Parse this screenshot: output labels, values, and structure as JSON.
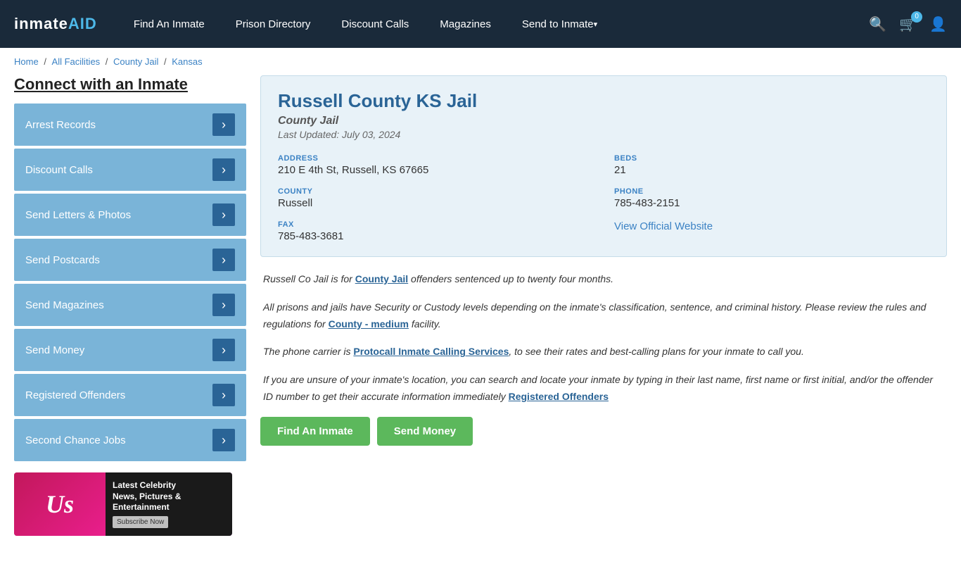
{
  "header": {
    "logo": "inmateAID",
    "nav": [
      {
        "label": "Find An Inmate",
        "dropdown": false
      },
      {
        "label": "Prison Directory",
        "dropdown": false
      },
      {
        "label": "Discount Calls",
        "dropdown": false
      },
      {
        "label": "Magazines",
        "dropdown": false
      },
      {
        "label": "Send to Inmate",
        "dropdown": true
      }
    ],
    "cart_count": "0"
  },
  "breadcrumb": {
    "items": [
      "Home",
      "All Facilities",
      "County Jail",
      "Kansas"
    ]
  },
  "sidebar": {
    "title": "Connect with an Inmate",
    "menu_items": [
      "Arrest Records",
      "Discount Calls",
      "Send Letters & Photos",
      "Send Postcards",
      "Send Magazines",
      "Send Money",
      "Registered Offenders",
      "Second Chance Jobs"
    ]
  },
  "ad": {
    "logo": "Us",
    "line1": "Latest Celebrity",
    "line2": "News, Pictures &",
    "line3": "Entertainment",
    "btn": "Subscribe Now"
  },
  "facility": {
    "title": "Russell County KS Jail",
    "type": "County Jail",
    "last_updated": "Last Updated: July 03, 2024",
    "address_label": "ADDRESS",
    "address": "210 E 4th St, Russell, KS 67665",
    "beds_label": "BEDS",
    "beds": "21",
    "county_label": "COUNTY",
    "county": "Russell",
    "phone_label": "PHONE",
    "phone": "785-483-2151",
    "fax_label": "FAX",
    "fax": "785-483-3681",
    "website_label": "View Official Website"
  },
  "description": {
    "para1_pre": "Russell Co Jail is for ",
    "para1_link": "County Jail",
    "para1_post": " offenders sentenced up to twenty four months.",
    "para2_pre": "All prisons and jails have Security or Custody levels depending on the inmate's classification, sentence, and criminal history. Please review the rules and regulations for ",
    "para2_link": "County - medium",
    "para2_post": " facility.",
    "para3_pre": "The phone carrier is ",
    "para3_link": "Protocall Inmate Calling Services",
    "para3_post": ", to see their rates and best-calling plans for your inmate to call you.",
    "para4_pre": "If you are unsure of your inmate's location, you can search and locate your inmate by typing in their last name, first name or first initial, and/or the offender ID number to get their accurate information immediately ",
    "para4_link": "Registered Offenders"
  },
  "bottom_buttons": [
    "Find An Inmate",
    "Send Money"
  ]
}
